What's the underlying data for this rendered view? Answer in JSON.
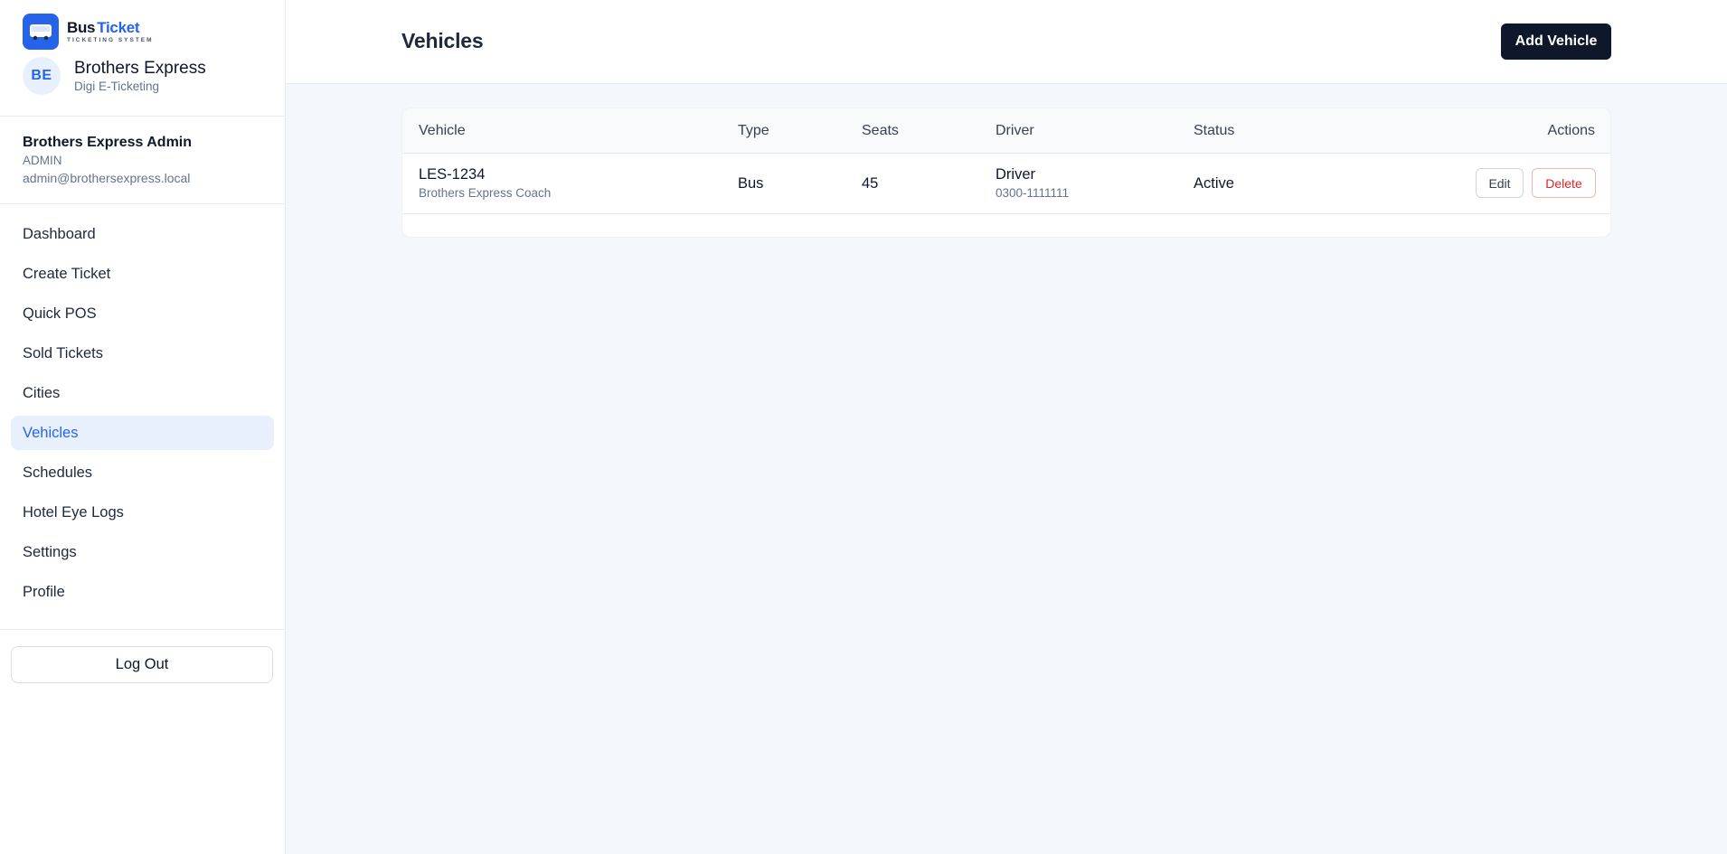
{
  "brand": {
    "name_part1": "Bus",
    "name_part2": "Ticket",
    "subtitle": "TICKETING SYSTEM",
    "icon": "bus-icon",
    "accent_color": "#2563eb"
  },
  "company": {
    "initials": "BE",
    "name": "Brothers Express",
    "tagline": "Digi E-Ticketing"
  },
  "user": {
    "name": "Brothers Express Admin",
    "role": "ADMIN",
    "email": "admin@brothersexpress.local"
  },
  "nav": {
    "items": [
      {
        "label": "Dashboard"
      },
      {
        "label": "Create Ticket"
      },
      {
        "label": "Quick POS"
      },
      {
        "label": "Sold Tickets"
      },
      {
        "label": "Cities"
      },
      {
        "label": "Vehicles",
        "active": true
      },
      {
        "label": "Schedules"
      },
      {
        "label": "Hotel Eye Logs"
      },
      {
        "label": "Settings"
      },
      {
        "label": "Profile"
      }
    ]
  },
  "logout_label": "Log Out",
  "header": {
    "title": "Vehicles",
    "add_button": "Add Vehicle"
  },
  "table": {
    "columns": [
      "Vehicle",
      "Type",
      "Seats",
      "Driver",
      "Status",
      "Actions"
    ],
    "rows": [
      {
        "vehicle": "LES-1234",
        "vehicle_sub": "Brothers Express Coach",
        "type": "Bus",
        "seats": "45",
        "driver": "Driver",
        "driver_phone": "0300-1111111",
        "status": "Active",
        "edit_label": "Edit",
        "delete_label": "Delete"
      }
    ]
  }
}
